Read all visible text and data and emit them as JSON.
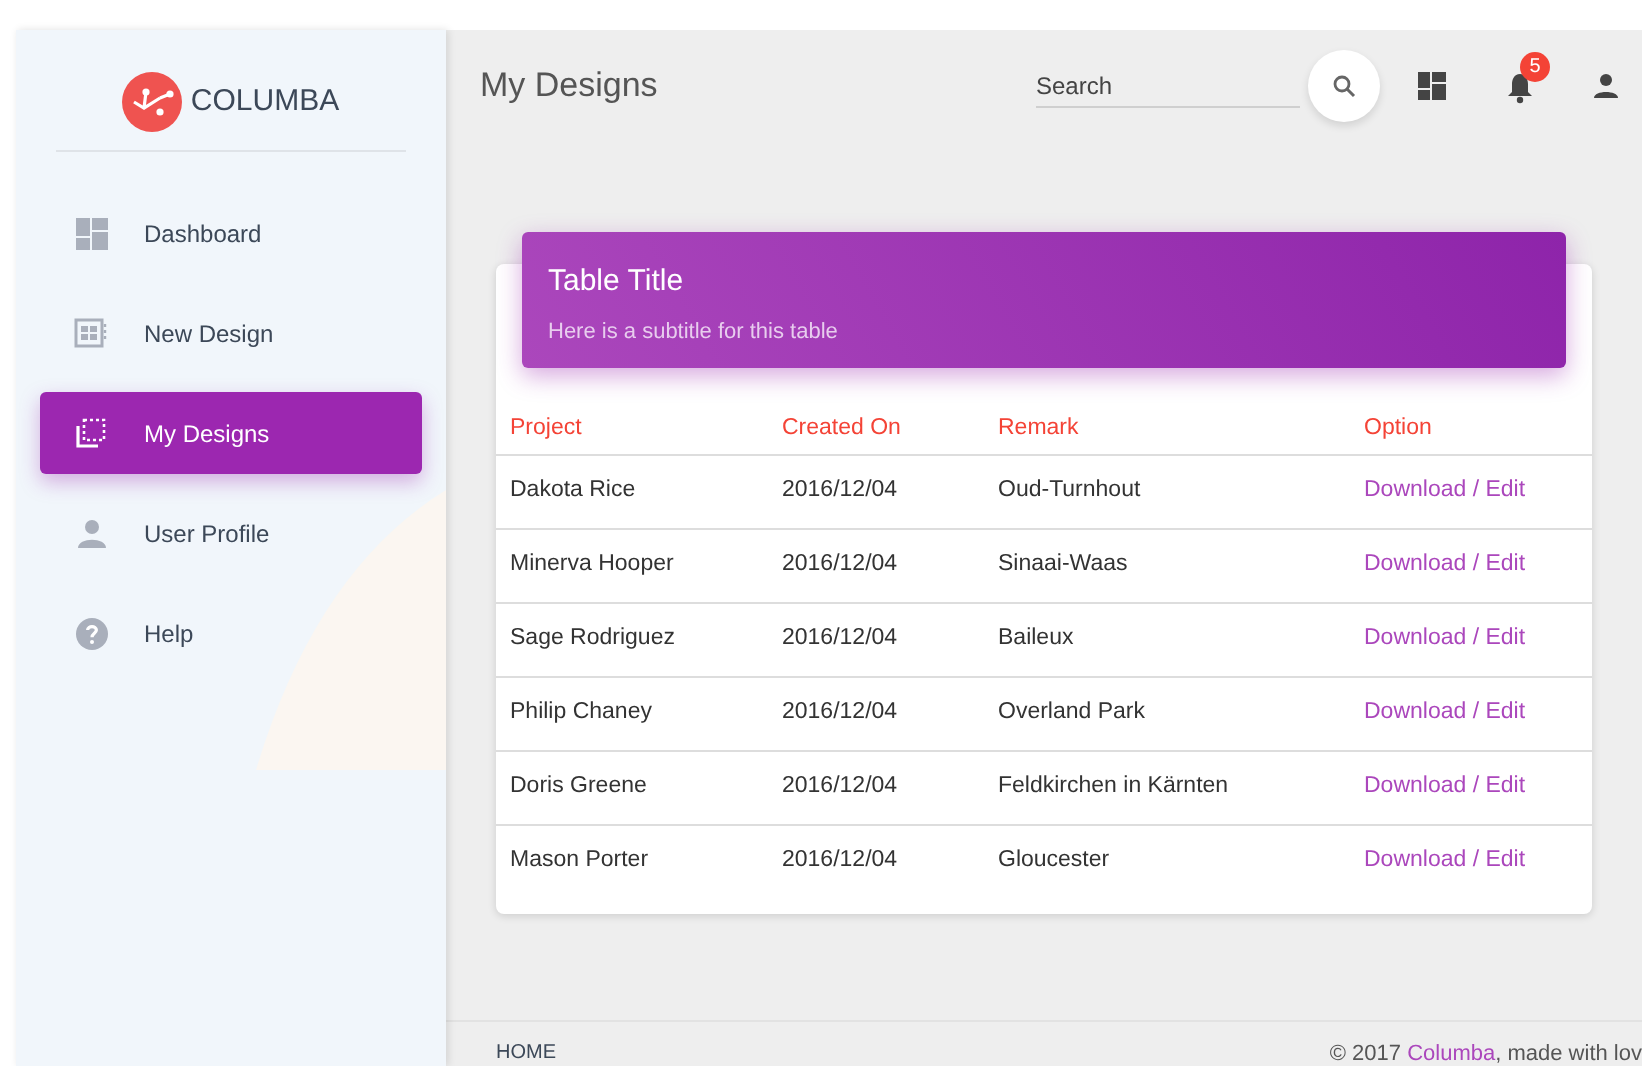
{
  "brand": {
    "name": "COLUMBA"
  },
  "sidebar": {
    "items": [
      {
        "label": "Dashboard",
        "kind": "dashboard",
        "selected": false
      },
      {
        "label": "New Design",
        "kind": "new",
        "selected": false
      },
      {
        "label": "My Designs",
        "kind": "designs",
        "selected": true
      },
      {
        "label": "User Profile",
        "kind": "profile",
        "selected": false
      },
      {
        "label": "Help",
        "kind": "help",
        "selected": false
      }
    ]
  },
  "topbar": {
    "title": "My Designs",
    "search": {
      "placeholder": "Search"
    },
    "notifications_badge": "5"
  },
  "table": {
    "title": "Table Title",
    "subtitle": "Here is a subtitle for this table",
    "columns": [
      "Project",
      "Created On",
      "Remark",
      "Option"
    ],
    "rows": [
      [
        "Dakota Rice",
        "2016/12/04",
        "Oud-Turnhout",
        "Download / Edit"
      ],
      [
        "Minerva Hooper",
        "2016/12/04",
        "Sinaai-Waas",
        "Download / Edit"
      ],
      [
        "Sage Rodriguez",
        "2016/12/04",
        "Baileux",
        "Download / Edit"
      ],
      [
        "Philip Chaney",
        "2016/12/04",
        "Overland Park",
        "Download / Edit"
      ],
      [
        "Doris Greene",
        "2016/12/04",
        "Feldkirchen in Kärnten",
        "Download / Edit"
      ],
      [
        "Mason Porter",
        "2016/12/04",
        "Gloucester",
        "Download / Edit"
      ]
    ]
  },
  "footer": {
    "link": "HOME",
    "copyright_before": "© 2017 ",
    "copyright_link": "Columba",
    "copyright_after": ", made with lov"
  }
}
